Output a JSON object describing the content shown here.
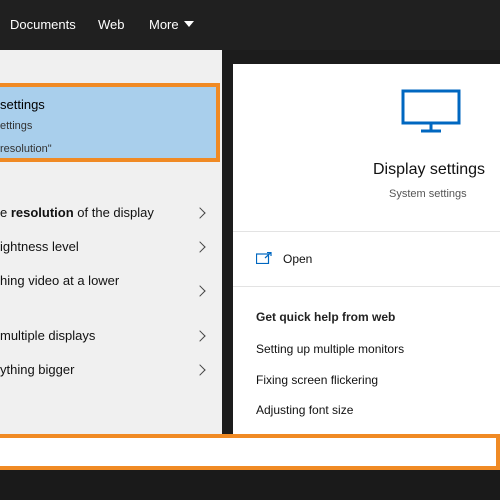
{
  "top_tabs": [
    {
      "label": "Documents"
    },
    {
      "label": "Web"
    },
    {
      "label": "More"
    }
  ],
  "best_match": {
    "title": "settings",
    "subtitle": "ettings",
    "match_text": "resolution\""
  },
  "results": [
    {
      "before": "e ",
      "bold": "resolution",
      "after": " of the display"
    },
    {
      "before": "ightness level",
      "bold": "",
      "after": ""
    },
    {
      "before": "hing video at a lower",
      "bold": "",
      "after": ""
    },
    {
      "before": " multiple displays",
      "bold": "",
      "after": ""
    },
    {
      "before": "ything bigger",
      "bold": "",
      "after": ""
    }
  ],
  "preview": {
    "icon": "monitor-icon",
    "title": "Display settings",
    "subtitle": "System settings",
    "open_label": "Open",
    "quick_help_title": "Get quick help from web",
    "links": [
      "Setting up multiple monitors",
      "Fixing screen flickering",
      "Adjusting font size"
    ]
  },
  "search": {
    "value": ""
  },
  "colors": {
    "accent_blue": "#0067c0",
    "highlight_orange": "#f08a24",
    "selection": "#a9cfec"
  }
}
